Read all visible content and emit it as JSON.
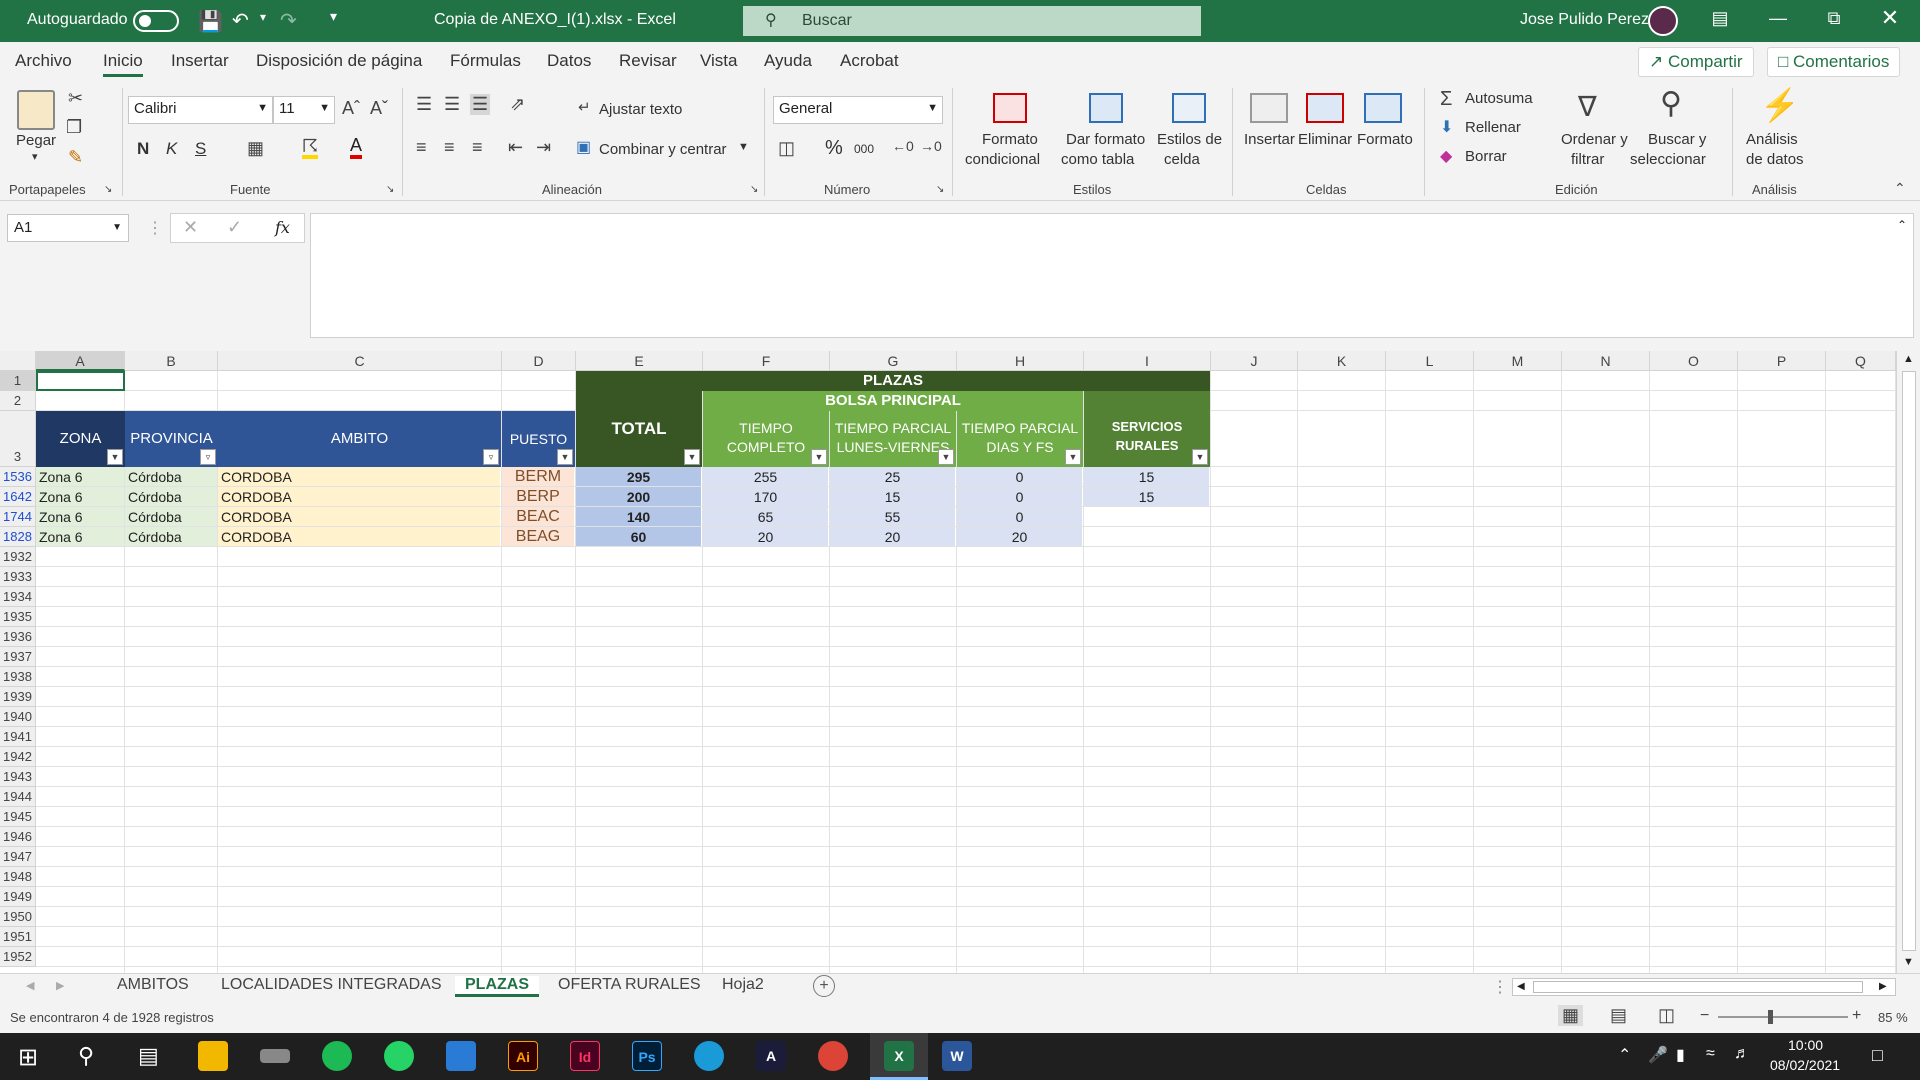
{
  "titlebar": {
    "autosave_label": "Autoguardado",
    "file_title": "Copia de ANEXO_I(1).xlsx  -  Excel",
    "search_placeholder": "Buscar",
    "user_name": "Jose Pulido Perez"
  },
  "menu": {
    "items": [
      "Archivo",
      "Inicio",
      "Insertar",
      "Disposición de página",
      "Fórmulas",
      "Datos",
      "Revisar",
      "Vista",
      "Ayuda",
      "Acrobat"
    ],
    "share": "Compartir",
    "comments": "Comentarios"
  },
  "ribbon": {
    "paste": "Pegar",
    "font_name": "Calibri",
    "font_size": "11",
    "bold": "N",
    "italic": "K",
    "underline": "S",
    "wrap_text": "Ajustar texto",
    "merge_center": "Combinar y centrar",
    "number_format": "General",
    "percent": "%",
    "thousands": "000",
    "cond_format_1": "Formato",
    "cond_format_2": "condicional",
    "format_table_1": "Dar formato",
    "format_table_2": "como tabla",
    "cell_styles_1": "Estilos de",
    "cell_styles_2": "celda",
    "insert": "Insertar",
    "delete": "Eliminar",
    "format": "Formato",
    "autosum": "Autosuma",
    "fill": "Rellenar",
    "clear": "Borrar",
    "sort_1": "Ordenar y",
    "sort_2": "filtrar",
    "find_1": "Buscar y",
    "find_2": "seleccionar",
    "analysis_1": "Análisis",
    "analysis_2": "de datos",
    "groups": {
      "clipboard": "Portapapeles",
      "font": "Fuente",
      "alignment": "Alineación",
      "number": "Número",
      "styles": "Estilos",
      "cells": "Celdas",
      "editing": "Edición",
      "analysis": "Análisis"
    }
  },
  "formula_bar": {
    "name_box": "A1",
    "fx": "fx"
  },
  "columns": [
    "A",
    "B",
    "C",
    "D",
    "E",
    "F",
    "G",
    "H",
    "I",
    "J",
    "K",
    "L",
    "M",
    "N",
    "O",
    "P",
    "Q"
  ],
  "header": {
    "plazas": "PLAZAS",
    "bolsa": "BOLSA PRINCIPAL",
    "zona": "ZONA",
    "provincia": "PROVINCIA",
    "ambito": "AMBITO",
    "puesto": "PUESTO",
    "total": "TOTAL",
    "tiempo_completo_1": "TIEMPO",
    "tiempo_completo_2": "COMPLETO",
    "parcial_lv_1": "TIEMPO PARCIAL",
    "parcial_lv_2": "LUNES-VIERNES",
    "parcial_fs_1": "TIEMPO PARCIAL",
    "parcial_fs_2": "DIAS Y FS",
    "servicios_1": "SERVICIOS",
    "servicios_2": "RURALES"
  },
  "rows": [
    {
      "row": "1536",
      "zona": "Zona 6",
      "provincia": "Córdoba",
      "ambito": "CORDOBA",
      "puesto": "BERM",
      "total": "295",
      "completo": "255",
      "lv": "25",
      "fs": "0",
      "rurales": "15"
    },
    {
      "row": "1642",
      "zona": "Zona 6",
      "provincia": "Córdoba",
      "ambito": "CORDOBA",
      "puesto": "BERP",
      "total": "200",
      "completo": "170",
      "lv": "15",
      "fs": "0",
      "rurales": "15"
    },
    {
      "row": "1744",
      "zona": "Zona 6",
      "provincia": "Córdoba",
      "ambito": "CORDOBA",
      "puesto": "BEAC",
      "total": "140",
      "completo": "65",
      "lv": "55",
      "fs": "0",
      "rurales": ""
    },
    {
      "row": "1828",
      "zona": "Zona 6",
      "provincia": "Córdoba",
      "ambito": "CORDOBA",
      "puesto": "BEAG",
      "total": "60",
      "completo": "20",
      "lv": "20",
      "fs": "20",
      "rurales": ""
    }
  ],
  "empty_rows": [
    "1932",
    "1933",
    "1934",
    "1935",
    "1936",
    "1937",
    "1938",
    "1939",
    "1940",
    "1941",
    "1942",
    "1943",
    "1944",
    "1945",
    "1946",
    "1947",
    "1948",
    "1949",
    "1950",
    "1951",
    "1952"
  ],
  "sheets": [
    "AMBITOS",
    "LOCALIDADES INTEGRADAS",
    "PLAZAS",
    "OFERTA RURALES",
    "Hoja2"
  ],
  "status": {
    "message": "Se encontraron 4 de 1928 registros",
    "zoom": "85 %"
  },
  "taskbar": {
    "time": "10:00",
    "date": "08/02/2021"
  },
  "colors": {
    "excel_green": "#217346",
    "header_blue": "#2f5597",
    "header_dark_navy": "#1f3864",
    "header_dark_green": "#375623",
    "header_green": "#70ad47"
  }
}
